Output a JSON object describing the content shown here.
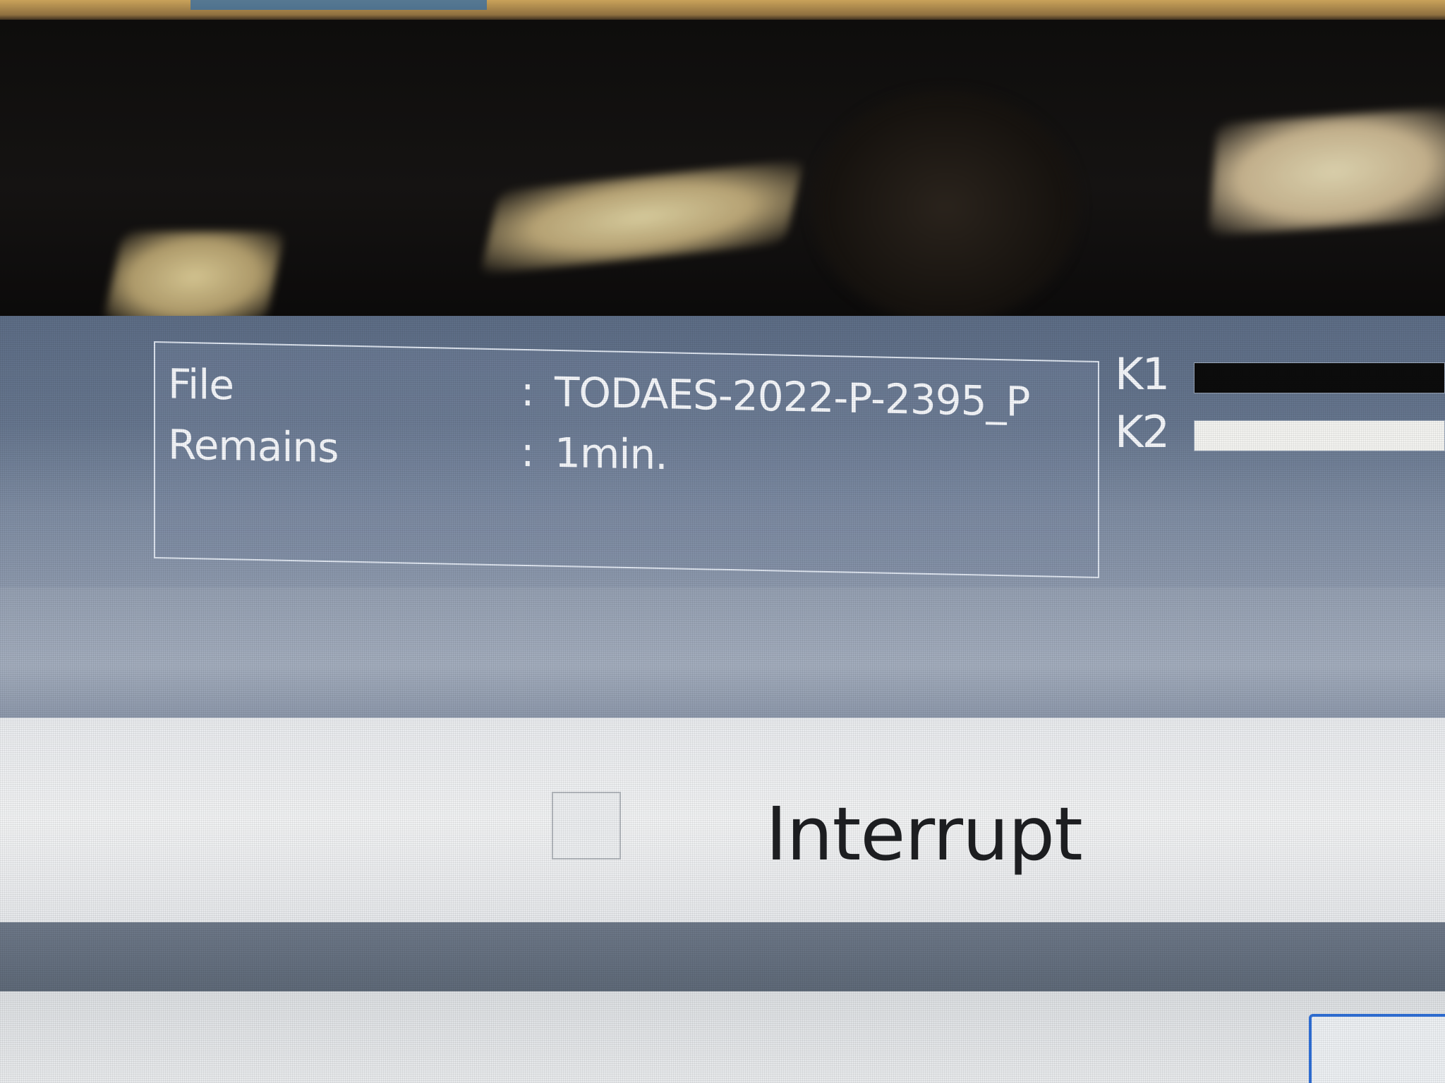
{
  "status": {
    "file_label": "File",
    "file_colon": ":",
    "file_value": "TODAES-2022-P-2395_P",
    "remains_label": "Remains",
    "remains_colon": ":",
    "remains_value": "1min."
  },
  "meters": [
    {
      "label": "K1",
      "fill_fraction": 0.0
    },
    {
      "label": "K2",
      "fill_fraction": 1.0
    }
  ],
  "actions": {
    "interrupt_label": "Interrupt"
  },
  "colors": {
    "screen_bg": "#6e7f96",
    "panel_text": "#f4f6fa",
    "button_band": "#f1f2f3",
    "accent_focus": "#2f6fd6"
  }
}
